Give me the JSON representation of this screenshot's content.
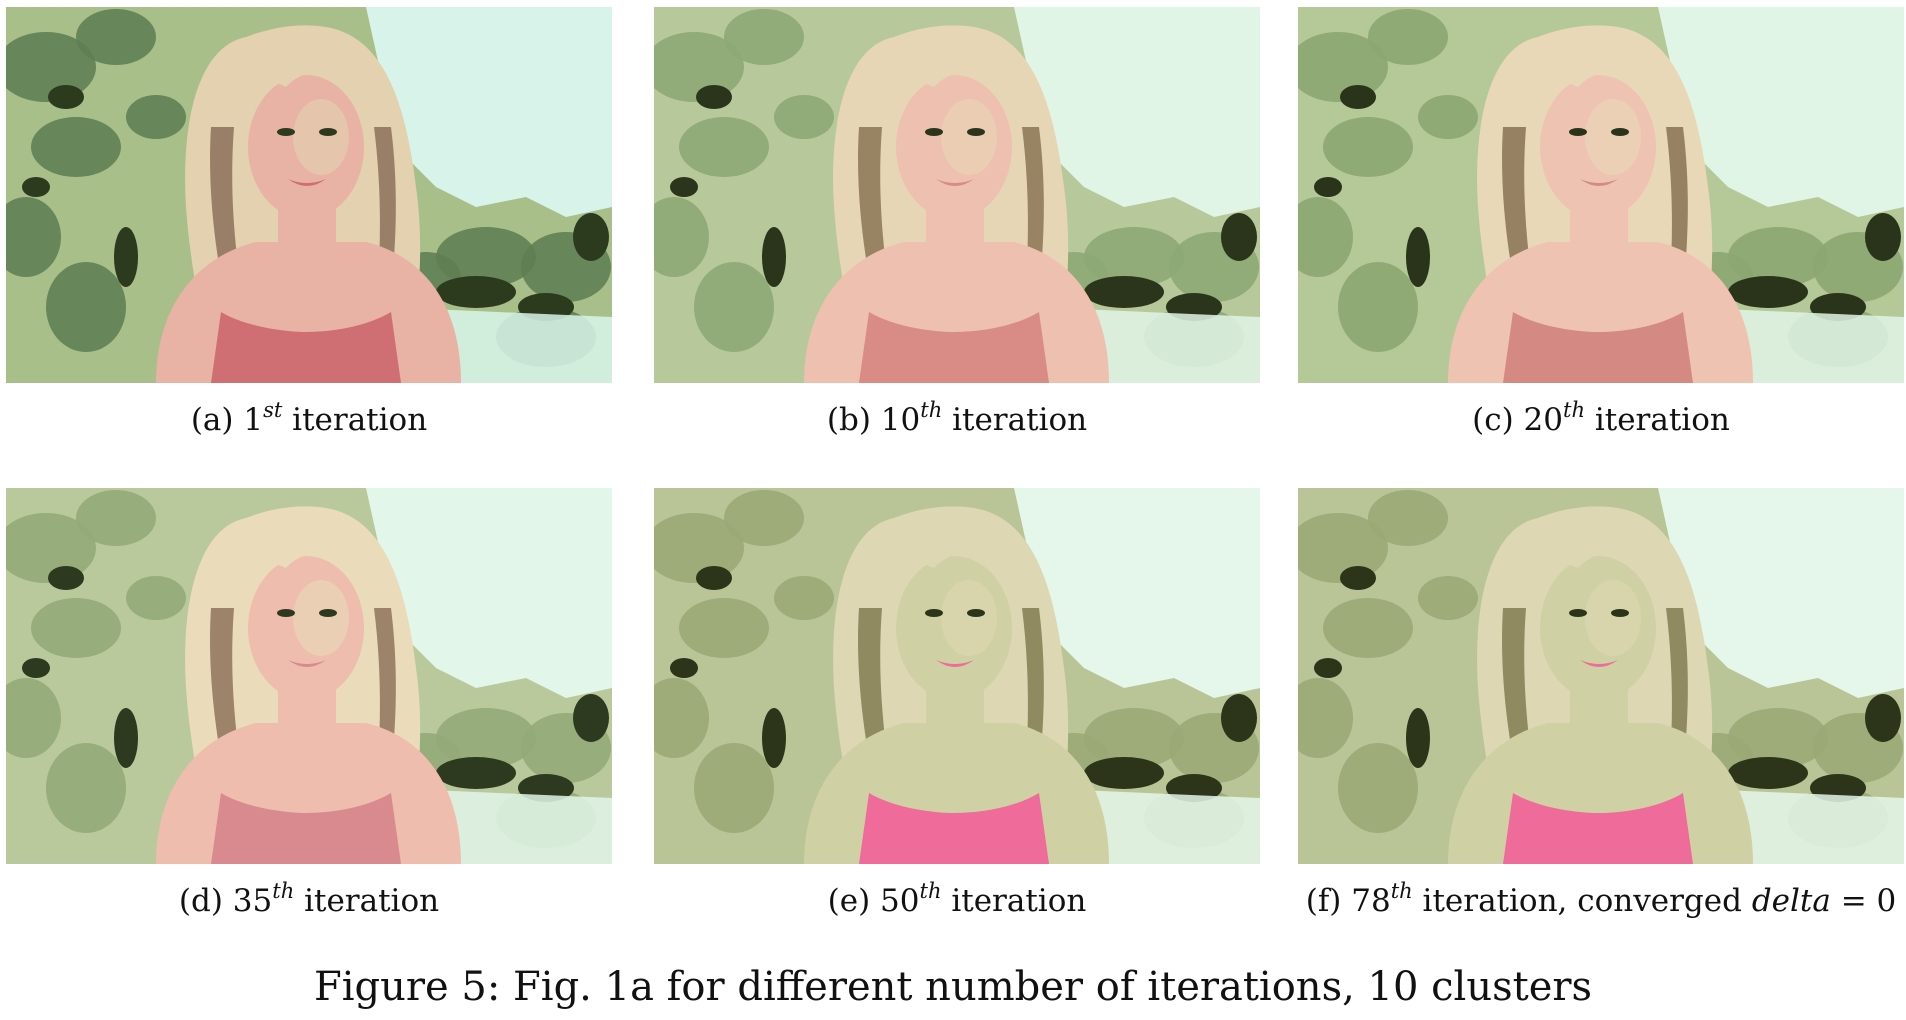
{
  "panels": [
    {
      "label": "(a)",
      "ordinal": "1",
      "suffix": "st",
      "text": "iteration",
      "extra_pre": "",
      "extra_math": "",
      "extra_post": "",
      "palette": {
        "sky": "#d8f4ea",
        "bg": "#a8bf8a",
        "dark": "#2c3a1e",
        "mid": "#5f7f53",
        "shirt": "#cf6f73",
        "skin": "#e8b3a4",
        "hair": "#e3d1b0",
        "shadow": "#7a5c4a"
      }
    },
    {
      "label": "(b)",
      "ordinal": "10",
      "suffix": "th",
      "text": "iteration",
      "extra_pre": "",
      "extra_math": "",
      "extra_post": "",
      "palette": {
        "sky": "#e1f5e6",
        "bg": "#b7c99a",
        "dark": "#2b351b",
        "mid": "#8da874",
        "shirt": "#d98b86",
        "skin": "#edc0af",
        "hair": "#e7d6b6",
        "shadow": "#76603f"
      }
    },
    {
      "label": "(c)",
      "ordinal": "20",
      "suffix": "th",
      "text": "iteration",
      "extra_pre": "",
      "extra_math": "",
      "extra_post": "",
      "palette": {
        "sky": "#e1f5e6",
        "bg": "#b5c898",
        "dark": "#2a341a",
        "mid": "#8ca671",
        "shirt": "#d58983",
        "skin": "#efc3b1",
        "hair": "#e8d8b8",
        "shadow": "#745c3e"
      }
    },
    {
      "label": "(d)",
      "ordinal": "35",
      "suffix": "th",
      "text": "iteration",
      "extra_pre": "",
      "extra_math": "",
      "extra_post": "",
      "palette": {
        "sky": "#e2f6ea",
        "bg": "#b9c99c",
        "dark": "#2e3a1f",
        "mid": "#93aa78",
        "shirt": "#d98a8f",
        "skin": "#eebdad",
        "hair": "#eadbbb",
        "shadow": "#7a5e46"
      }
    },
    {
      "label": "(e)",
      "ordinal": "50",
      "suffix": "th",
      "text": "iteration",
      "extra_pre": "",
      "extra_math": "",
      "extra_post": "",
      "palette": {
        "sky": "#e5f6ea",
        "bg": "#b9c597",
        "dark": "#2c3419",
        "mid": "#9aa976",
        "shirt": "#ef6b9a",
        "skin": "#cfd1a5",
        "hair": "#ded7b3",
        "shadow": "#6f6a3e"
      }
    },
    {
      "label": "(f)",
      "ordinal": "78",
      "suffix": "th",
      "text": "iteration, converged",
      "extra_pre": "",
      "extra_math": "delta",
      "extra_post": " = 0",
      "palette": {
        "sky": "#e5f6ea",
        "bg": "#b9c597",
        "dark": "#2c3419",
        "mid": "#9aa976",
        "shirt": "#ef6b9a",
        "skin": "#cfd1a5",
        "hair": "#ded7b3",
        "shadow": "#6f6a3e"
      }
    }
  ],
  "figure_caption": "Figure 5: Fig. 1a for different number of iterations, 10 clusters"
}
